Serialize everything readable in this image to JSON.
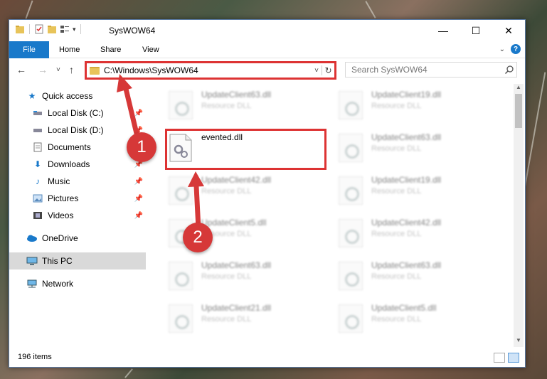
{
  "window": {
    "title": "SysWOW64",
    "minimize": "—",
    "maximize": "☐",
    "close": "✕"
  },
  "ribbon": {
    "file": "File",
    "home": "Home",
    "share": "Share",
    "view": "View",
    "help": "?"
  },
  "nav": {
    "back": "←",
    "forward": "→",
    "recent": "˅",
    "up": "↑",
    "address": "C:\\Windows\\SysWOW64",
    "address_dropdown": "˅",
    "refresh": "↻",
    "search_placeholder": "Search SysWOW64"
  },
  "sidebar": {
    "items": [
      {
        "label": "Quick access",
        "icon": "star-icon"
      },
      {
        "label": "Local Disk (C:)",
        "icon": "drive-icon",
        "pinned": true
      },
      {
        "label": "Local Disk (D:)",
        "icon": "drive-icon",
        "pinned": true
      },
      {
        "label": "Documents",
        "icon": "documents-icon",
        "pinned": true
      },
      {
        "label": "Downloads",
        "icon": "download-icon",
        "pinned": true
      },
      {
        "label": "Music",
        "icon": "music-icon",
        "pinned": true
      },
      {
        "label": "Pictures",
        "icon": "pictures-icon",
        "pinned": true
      },
      {
        "label": "Videos",
        "icon": "videos-icon",
        "pinned": true
      },
      {
        "label": "OneDrive",
        "icon": "cloud-icon"
      },
      {
        "label": "This PC",
        "icon": "computer-icon",
        "selected": true
      },
      {
        "label": "Network",
        "icon": "network-icon"
      }
    ]
  },
  "files": [
    {
      "name": "UpdateClient63.dll",
      "type": "Resource DLL",
      "blurred": true
    },
    {
      "name": "UpdateClient19.dll",
      "type": "Resource DLL",
      "blurred": true
    },
    {
      "name": "evented.dll",
      "type": "",
      "blurred": false
    },
    {
      "name": "UpdateClient63.dll",
      "type": "Resource DLL",
      "blurred": true
    },
    {
      "name": "UpdateClient42.dll",
      "type": "Resource DLL",
      "blurred": true
    },
    {
      "name": "UpdateClient19.dll",
      "type": "Resource DLL",
      "blurred": true
    },
    {
      "name": "UpdateClient5.dll",
      "type": "Resource DLL",
      "blurred": true
    },
    {
      "name": "UpdateClient42.dll",
      "type": "Resource DLL",
      "blurred": true
    },
    {
      "name": "UpdateClient63.dll",
      "type": "Resource DLL",
      "blurred": true
    },
    {
      "name": "UpdateClient63.dll",
      "type": "Resource DLL",
      "blurred": true
    },
    {
      "name": "UpdateClient21.dll",
      "type": "Resource DLL",
      "blurred": true
    },
    {
      "name": "UpdateClient5.dll",
      "type": "Resource DLL",
      "blurred": true
    }
  ],
  "status": {
    "item_count": "196 items"
  },
  "annotations": {
    "step1": "1",
    "step2": "2",
    "color": "#d63838"
  }
}
